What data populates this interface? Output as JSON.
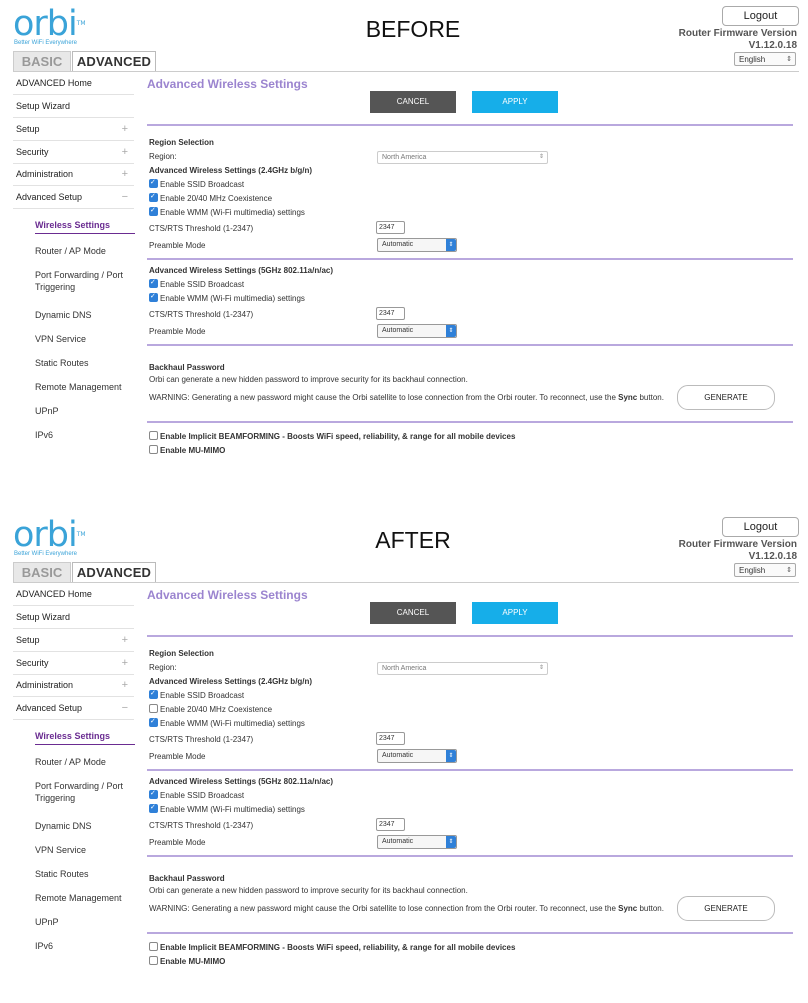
{
  "panels": [
    {
      "label": "BEFORE",
      "logo": {
        "text": "orbi",
        "tm": "TM",
        "tagline": "Better WiFi Everywhere"
      },
      "tabs": {
        "basic": "BASIC",
        "advanced": "ADVANCED"
      },
      "header": {
        "logout": "Logout",
        "fw_label": "Router Firmware Version",
        "fw_version": "V1.12.0.18",
        "language": "English"
      },
      "nav": {
        "items": [
          "ADVANCED Home",
          "Setup Wizard",
          "Setup",
          "Security",
          "Administration",
          "Advanced Setup"
        ],
        "sub": [
          "Wireless Settings",
          "Router / AP Mode",
          "Port Forwarding / Port Triggering",
          "Dynamic DNS",
          "VPN Service",
          "Static Routes",
          "Remote Management",
          "UPnP",
          "IPv6"
        ]
      },
      "page_title": "Advanced Wireless Settings",
      "buttons": {
        "cancel": "CANCEL",
        "apply": "APPLY",
        "generate": "GENERATE"
      },
      "region": {
        "title": "Region Selection",
        "label": "Region:",
        "value": "North America"
      },
      "band24": {
        "title": "Advanced Wireless Settings (2.4GHz b/g/n)",
        "ssid_broadcast": {
          "label": "Enable SSID Broadcast",
          "checked": true
        },
        "coexistence": {
          "label": "Enable 20/40 MHz Coexistence",
          "checked": true
        },
        "wmm": {
          "label": "Enable WMM (Wi-Fi multimedia) settings",
          "checked": true
        },
        "cts_label": "CTS/RTS Threshold (1-2347)",
        "cts_value": "2347",
        "preamble_label": "Preamble Mode",
        "preamble_value": "Automatic"
      },
      "band5": {
        "title": "Advanced Wireless Settings (5GHz 802.11a/n/ac)",
        "ssid_broadcast": {
          "label": "Enable SSID Broadcast",
          "checked": true
        },
        "wmm": {
          "label": "Enable WMM (Wi-Fi multimedia) settings",
          "checked": true
        },
        "cts_label": "CTS/RTS Threshold (1-2347)",
        "cts_value": "2347",
        "preamble_label": "Preamble Mode",
        "preamble_value": "Automatic"
      },
      "backhaul": {
        "title": "Backhaul Password",
        "desc": "Orbi can generate a new hidden password to improve security for its backhaul connection.",
        "warning_pre": "WARNING: Generating a new password might cause the Orbi satellite to lose connection from the Orbi router. To reconnect, use the ",
        "warning_bold": "Sync",
        "warning_post": " button."
      },
      "beamforming": {
        "label": "Enable Implicit BEAMFORMING - Boosts WiFi speed, reliability, & range for all mobile devices",
        "checked": false
      },
      "mumimo": {
        "label": "Enable MU-MIMO",
        "checked": false
      }
    },
    {
      "label": "AFTER",
      "logo": {
        "text": "orbi",
        "tm": "TM",
        "tagline": "Better WiFi Everywhere"
      },
      "tabs": {
        "basic": "BASIC",
        "advanced": "ADVANCED"
      },
      "header": {
        "logout": "Logout",
        "fw_label": "Router Firmware Version",
        "fw_version": "V1.12.0.18",
        "language": "English"
      },
      "nav": {
        "items": [
          "ADVANCED Home",
          "Setup Wizard",
          "Setup",
          "Security",
          "Administration",
          "Advanced Setup"
        ],
        "sub": [
          "Wireless Settings",
          "Router / AP Mode",
          "Port Forwarding / Port Triggering",
          "Dynamic DNS",
          "VPN Service",
          "Static Routes",
          "Remote Management",
          "UPnP",
          "IPv6"
        ]
      },
      "page_title": "Advanced Wireless Settings",
      "buttons": {
        "cancel": "CANCEL",
        "apply": "APPLY",
        "generate": "GENERATE"
      },
      "region": {
        "title": "Region Selection",
        "label": "Region:",
        "value": "North America"
      },
      "band24": {
        "title": "Advanced Wireless Settings (2.4GHz b/g/n)",
        "ssid_broadcast": {
          "label": "Enable SSID Broadcast",
          "checked": true
        },
        "coexistence": {
          "label": "Enable 20/40 MHz Coexistence",
          "checked": false
        },
        "wmm": {
          "label": "Enable WMM (Wi-Fi multimedia) settings",
          "checked": true
        },
        "cts_label": "CTS/RTS Threshold (1-2347)",
        "cts_value": "2347",
        "preamble_label": "Preamble Mode",
        "preamble_value": "Automatic"
      },
      "band5": {
        "title": "Advanced Wireless Settings (5GHz 802.11a/n/ac)",
        "ssid_broadcast": {
          "label": "Enable SSID Broadcast",
          "checked": true
        },
        "wmm": {
          "label": "Enable WMM (Wi-Fi multimedia) settings",
          "checked": true
        },
        "cts_label": "CTS/RTS Threshold (1-2347)",
        "cts_value": "2347",
        "preamble_label": "Preamble Mode",
        "preamble_value": "Automatic"
      },
      "backhaul": {
        "title": "Backhaul Password",
        "desc": "Orbi can generate a new hidden password to improve security for its backhaul connection.",
        "warning_pre": "WARNING: Generating a new password might cause the Orbi satellite to lose connection from the Orbi router. To reconnect, use the ",
        "warning_bold": "Sync",
        "warning_post": " button."
      },
      "beamforming": {
        "label": "Enable Implicit BEAMFORMING - Boosts WiFi speed, reliability, & range for all mobile devices",
        "checked": false
      },
      "mumimo": {
        "label": "Enable MU-MIMO",
        "checked": false
      }
    }
  ],
  "colors": {
    "accent_purple": "#6a2c91",
    "title_lavender": "#9b84cf",
    "apply_blue": "#16aee9",
    "cancel_gray": "#555555",
    "logo_blue": "#3aa3d8"
  }
}
